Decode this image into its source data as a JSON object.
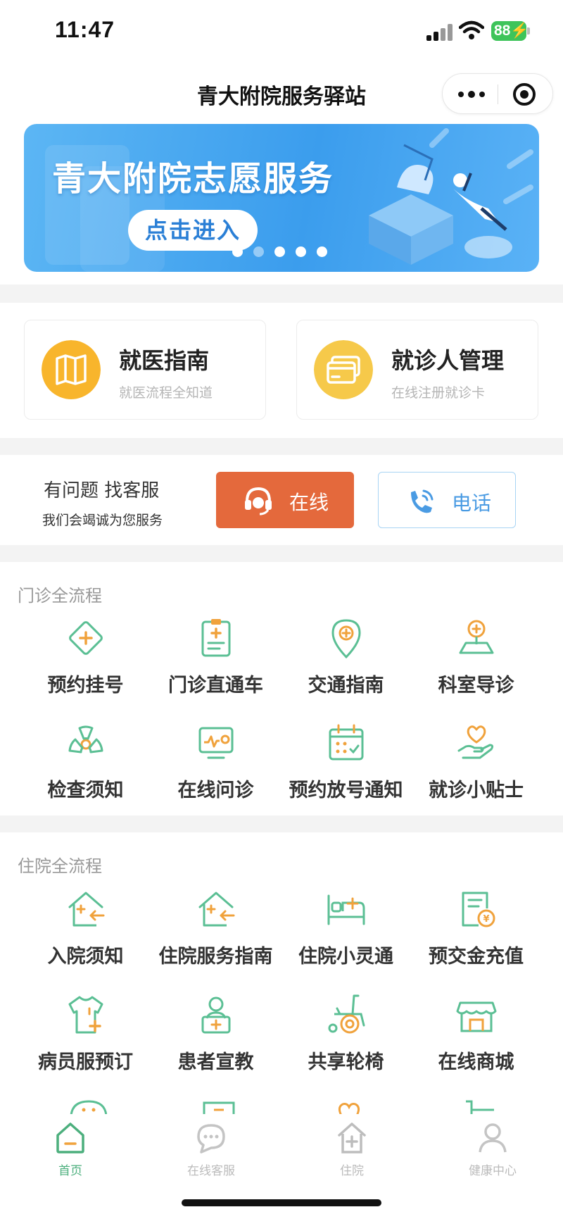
{
  "status_bar": {
    "time": "11:47",
    "battery": "88"
  },
  "nav": {
    "title": "青大附院服务驿站",
    "more_icon": "more-icon",
    "close_icon": "target-icon"
  },
  "banner": {
    "title": "青大附院志愿服务",
    "button": "点击进入",
    "dots": 5,
    "active_dot": 2
  },
  "guide_cards": [
    {
      "title": "就医指南",
      "subtitle": "就医流程全知道",
      "icon": "map-icon",
      "color": "#f8b52c"
    },
    {
      "title": "就诊人管理",
      "subtitle": "在线注册就诊卡",
      "icon": "card-icon",
      "color": "#f6c94a"
    }
  ],
  "service": {
    "title": "有问题 找客服",
    "subtitle": "我们会竭诚为您服务",
    "online_label": "在线",
    "phone_label": "电话"
  },
  "outpatient": {
    "title": "门诊全流程",
    "items": [
      {
        "label": "预约挂号",
        "icon": "appointment-icon"
      },
      {
        "label": "门诊直通车",
        "icon": "clipboard-icon"
      },
      {
        "label": "交通指南",
        "icon": "location-pin-icon"
      },
      {
        "label": "科室导诊",
        "icon": "department-map-icon"
      },
      {
        "label": "检查须知",
        "icon": "radiation-icon"
      },
      {
        "label": "在线问诊",
        "icon": "online-consult-icon"
      },
      {
        "label": "预约放号通知",
        "icon": "calendar-icon"
      },
      {
        "label": "就诊小贴士",
        "icon": "heart-hand-icon"
      }
    ]
  },
  "inpatient": {
    "title": "住院全流程",
    "items": [
      {
        "label": "入院须知",
        "icon": "home-enter-icon"
      },
      {
        "label": "住院服务指南",
        "icon": "home-guide-icon"
      },
      {
        "label": "住院小灵通",
        "icon": "hospital-bed-icon"
      },
      {
        "label": "预交金充值",
        "icon": "bill-icon"
      },
      {
        "label": "病员服预订",
        "icon": "uniform-icon"
      },
      {
        "label": "患者宣教",
        "icon": "patient-icon"
      },
      {
        "label": "共享轮椅",
        "icon": "wheelchair-icon"
      },
      {
        "label": "在线商城",
        "icon": "shop-icon"
      }
    ]
  },
  "colors": {
    "green": "#5bbf94",
    "orange": "#f0a23c",
    "accent": "#e4693c",
    "blue": "#4a9be3"
  },
  "tabbar": [
    {
      "label": "首页",
      "icon": "home-icon",
      "active": true
    },
    {
      "label": "在线客服",
      "icon": "chat-icon",
      "active": false
    },
    {
      "label": "住院",
      "icon": "hospital-icon",
      "active": false
    },
    {
      "label": "健康中心",
      "icon": "user-icon",
      "active": false
    }
  ]
}
